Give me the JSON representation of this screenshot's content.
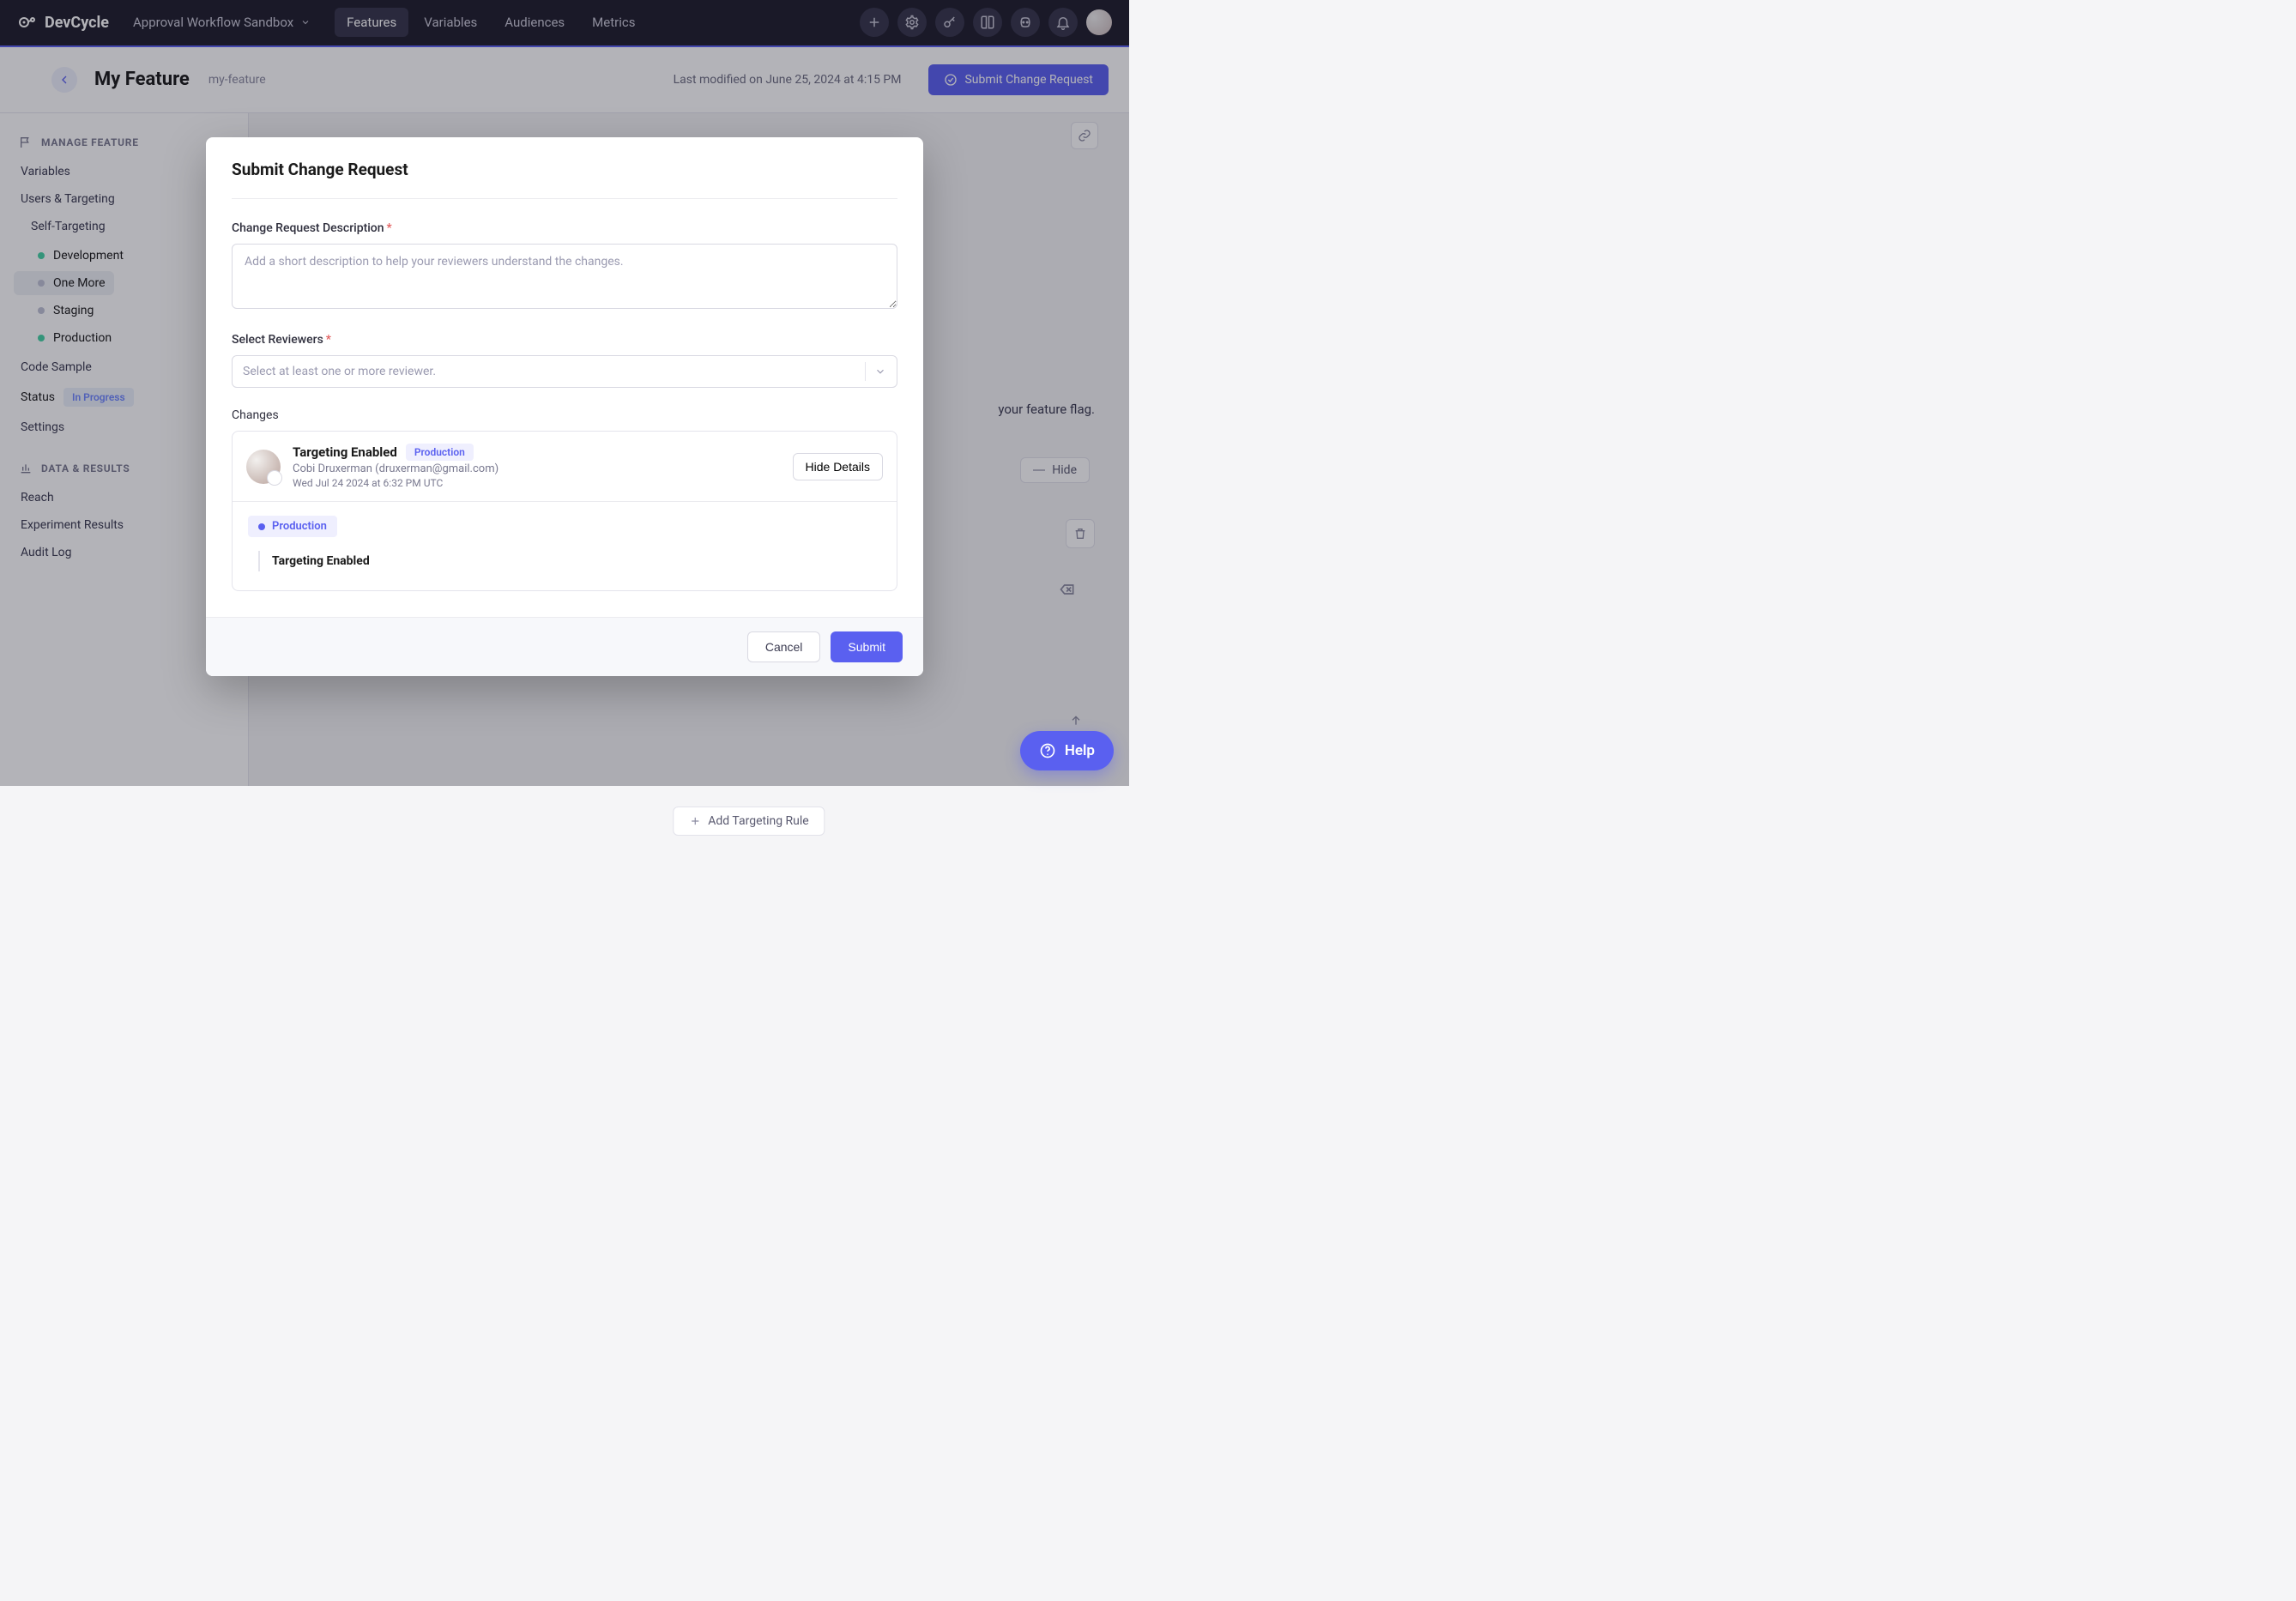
{
  "topbar": {
    "brand": "DevCycle",
    "project": "Approval Workflow Sandbox",
    "nav": {
      "features": "Features",
      "variables": "Variables",
      "audiences": "Audiences",
      "metrics": "Metrics"
    }
  },
  "page": {
    "title": "My Feature",
    "slug": "my-feature",
    "last_modified": "Last modified on June 25, 2024 at 4:15 PM",
    "submit_button": "Submit Change Request"
  },
  "sidebar": {
    "section_manage": "MANAGE FEATURE",
    "variables": "Variables",
    "users_targeting": "Users & Targeting",
    "self_targeting": "Self-Targeting",
    "envs": {
      "development": "Development",
      "one_more": "One More",
      "staging": "Staging",
      "production": "Production"
    },
    "code_sample": "Code Sample",
    "status_label": "Status",
    "status_value": "In Progress",
    "settings": "Settings",
    "section_data": "DATA & RESULTS",
    "reach": "Reach",
    "experiment_results": "Experiment Results",
    "audit_log": "Audit Log"
  },
  "content": {
    "hint_fragment": "your feature flag.",
    "hide": "Hide",
    "add_rule": "Add Targeting Rule"
  },
  "modal": {
    "title": "Submit Change Request",
    "desc_label": "Change Request Description",
    "desc_placeholder": "Add a short description to help your reviewers understand the changes.",
    "reviewers_label": "Select Reviewers",
    "reviewers_placeholder": "Select at least one or more reviewer.",
    "changes_label": "Changes",
    "change": {
      "title": "Targeting Enabled",
      "env": "Production",
      "author": "Cobi Druxerman (druxerman@gmail.com)",
      "timestamp": "Wed Jul 24 2024 at 6:32 PM UTC"
    },
    "hide_details": "Hide Details",
    "detail_env": "Production",
    "detail_line": "Targeting Enabled",
    "cancel": "Cancel",
    "submit": "Submit"
  },
  "help": "Help"
}
